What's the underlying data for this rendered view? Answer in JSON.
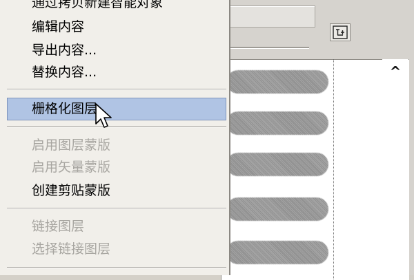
{
  "menu": {
    "items": [
      {
        "label": "通过拷贝新建智能对象",
        "disabled": false
      },
      {
        "label": "编辑内容",
        "disabled": false
      },
      {
        "label": "导出内容...",
        "disabled": false
      },
      {
        "label": "替换内容...",
        "disabled": false
      },
      {
        "label": "栅格化图层",
        "disabled": false,
        "highlighted": true
      },
      {
        "label": "启用图层蒙版",
        "disabled": true
      },
      {
        "label": "启用矢量蒙版",
        "disabled": true
      },
      {
        "label": "创建剪贴蒙版",
        "disabled": false
      },
      {
        "label": "链接图层",
        "disabled": true
      },
      {
        "label": "选择链接图层",
        "disabled": true
      }
    ]
  },
  "panel": {
    "icon_name": "brush-preset-icon",
    "scroll_up_glyph": "^"
  },
  "colors": {
    "menu_bg": "#f1efea",
    "highlight": "#b0c4e4",
    "disabled_text": "#a8a6a1"
  }
}
